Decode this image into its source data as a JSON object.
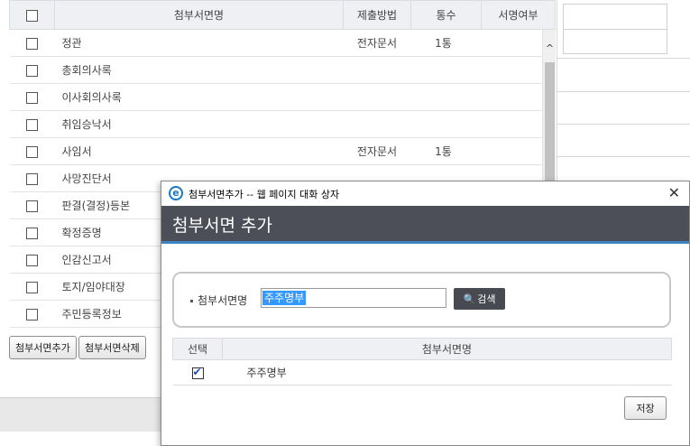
{
  "attachments": {
    "headers": {
      "name": "첨부서면명",
      "method": "제출방법",
      "count": "통수",
      "signed": "서명여부"
    },
    "rows": [
      {
        "name": "정관",
        "method": "전자문서",
        "count": "1통"
      },
      {
        "name": "총회의사록",
        "method": "",
        "count": ""
      },
      {
        "name": "이사회의사록",
        "method": "",
        "count": ""
      },
      {
        "name": "취임승낙서",
        "method": "",
        "count": ""
      },
      {
        "name": "사임서",
        "method": "전자문서",
        "count": "1통"
      },
      {
        "name": "사망진단서",
        "method": "",
        "count": ""
      },
      {
        "name": "판결(결정)등본",
        "method": "",
        "count": ""
      },
      {
        "name": "확정증명",
        "method": "",
        "count": ""
      },
      {
        "name": "인감신고서",
        "method": "",
        "count": ""
      },
      {
        "name": "토지/임야대장",
        "method": "",
        "count": ""
      },
      {
        "name": "주민등록정보",
        "method": "",
        "count": ""
      }
    ],
    "scroll_up_glyph": "^"
  },
  "buttons": {
    "add": "첨부서면추가",
    "delete": "첨부서면삭제"
  },
  "dialog": {
    "window_title": "첨부서면추가 -- 웹 페이지 대화 상자",
    "heading": "첨부서면 추가",
    "close_glyph": "✕",
    "ie_glyph": "e",
    "search": {
      "label": "첨부서면명",
      "value": "주주명부",
      "button": "검색",
      "button_glyph": "🔍"
    },
    "table": {
      "headers": {
        "select": "선택",
        "name": "첨부서면명"
      },
      "rows": [
        {
          "name": "주주명부",
          "checked": true
        }
      ]
    },
    "save": "저장"
  },
  "colors": {
    "dialog_header": "#4c4f57",
    "accent_blue": "#3f83c2",
    "selection": "#3399ff"
  }
}
